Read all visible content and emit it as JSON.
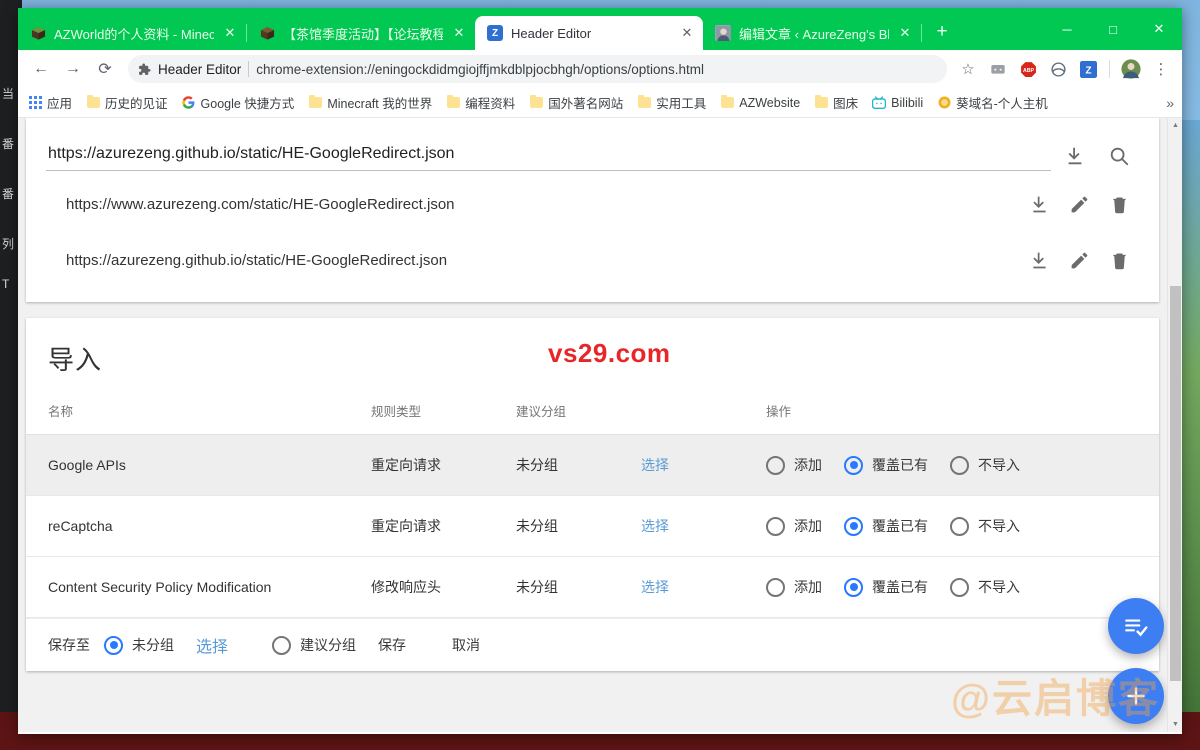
{
  "window": {
    "controls": {
      "minimize": "─",
      "maximize": "□",
      "close": "✕"
    }
  },
  "tabs": [
    {
      "title": "AZWorld的个人资料 - Minecraft",
      "favicon": "minecraft-block-icon",
      "close": "✕",
      "active": false
    },
    {
      "title": "【茶馆季度活动】【论坛教程组",
      "favicon": "minecraft-block-icon",
      "close": "✕",
      "active": false
    },
    {
      "title": "Header Editor",
      "favicon": "header-editor-icon",
      "close": "✕",
      "active": true
    },
    {
      "title": "编辑文章 ‹ AzureZeng's Blog —",
      "favicon": "blog-avatar-icon",
      "close": "✕",
      "active": false
    }
  ],
  "newtab_label": "+",
  "navbar": {
    "back": "←",
    "forward": "→",
    "reload": "⟳",
    "extension_name": "Header Editor",
    "url": "chrome-extension://eningockdidmgiojffjmkdblpjocbhgh/options/options.html",
    "bookmark_star": "☆",
    "menu": "⋮",
    "toolbar_icons": [
      {
        "name": "reading-list-icon",
        "label": ""
      },
      {
        "name": "adblock-plus-icon",
        "label": "ABP"
      },
      {
        "name": "sync-icon",
        "label": ""
      },
      {
        "name": "header-editor-icon",
        "label": "Z"
      },
      {
        "name": "profile-avatar-icon",
        "label": ""
      }
    ]
  },
  "bookmarks": {
    "apps_label": "应用",
    "items": [
      {
        "label": "历史的见证",
        "icon": "folder-icon"
      },
      {
        "label": "Google 快捷方式",
        "icon": "google-icon"
      },
      {
        "label": "Minecraft 我的世界",
        "icon": "folder-icon"
      },
      {
        "label": "编程资料",
        "icon": "folder-icon"
      },
      {
        "label": "国外著名网站",
        "icon": "folder-icon"
      },
      {
        "label": "实用工具",
        "icon": "folder-icon"
      },
      {
        "label": "AZWebsite",
        "icon": "folder-icon"
      },
      {
        "label": "图床",
        "icon": "folder-icon"
      },
      {
        "label": "Bilibili",
        "icon": "bilibili-icon"
      },
      {
        "label": "葵域名-个人主机",
        "icon": "globe-icon"
      }
    ],
    "overflow": "»"
  },
  "download_card": {
    "input_value": "https://azurezeng.github.io/static/HE-GoogleRedirect.json",
    "input_placeholder": "",
    "download_icon": "download-icon",
    "search_icon": "search-icon",
    "items": [
      {
        "url": "https://www.azurezeng.com/static/HE-GoogleRedirect.json"
      },
      {
        "url": "https://azurezeng.github.io/static/HE-GoogleRedirect.json"
      }
    ],
    "item_actions": [
      "download-icon",
      "edit-icon",
      "delete-icon"
    ]
  },
  "import_card": {
    "title": "导入",
    "watermark": "vs29.com",
    "watermark_color": "#e8262a",
    "columns": {
      "name": "名称",
      "rule_type": "规则类型",
      "suggested_group": "建议分组",
      "actions": "操作"
    },
    "select_link": "选择",
    "action_options": [
      {
        "label": "添加",
        "selected": false
      },
      {
        "label": "覆盖已有",
        "selected": true
      },
      {
        "label": "不导入",
        "selected": false
      }
    ],
    "rows": [
      {
        "name": "Google APIs",
        "rule_type": "重定向请求",
        "group": "未分组",
        "select": "选择",
        "shaded": true
      },
      {
        "name": "reCaptcha",
        "rule_type": "重定向请求",
        "group": "未分组",
        "select": "选择",
        "shaded": false
      },
      {
        "name": "Content Security Policy Modification",
        "rule_type": "修改响应头",
        "group": "未分组",
        "select": "选择",
        "shaded": false
      }
    ],
    "savebar": {
      "lead": "保存至",
      "option_ungrouped": {
        "label": "未分组",
        "selected": true
      },
      "select_link": "选择",
      "option_suggested": {
        "label": "建议分组",
        "selected": false
      },
      "save": "保存",
      "cancel": "取消"
    }
  },
  "fabs": [
    {
      "name": "confirm-import-fab",
      "icon": "playlist-check-icon",
      "color": "#3d7ff2"
    },
    {
      "name": "add-rule-fab",
      "icon": "plus-icon",
      "color": "#3d7ff2"
    }
  ],
  "page_watermark": "@云启博客",
  "scrollbar": {
    "up": "▲",
    "down": "▼"
  }
}
